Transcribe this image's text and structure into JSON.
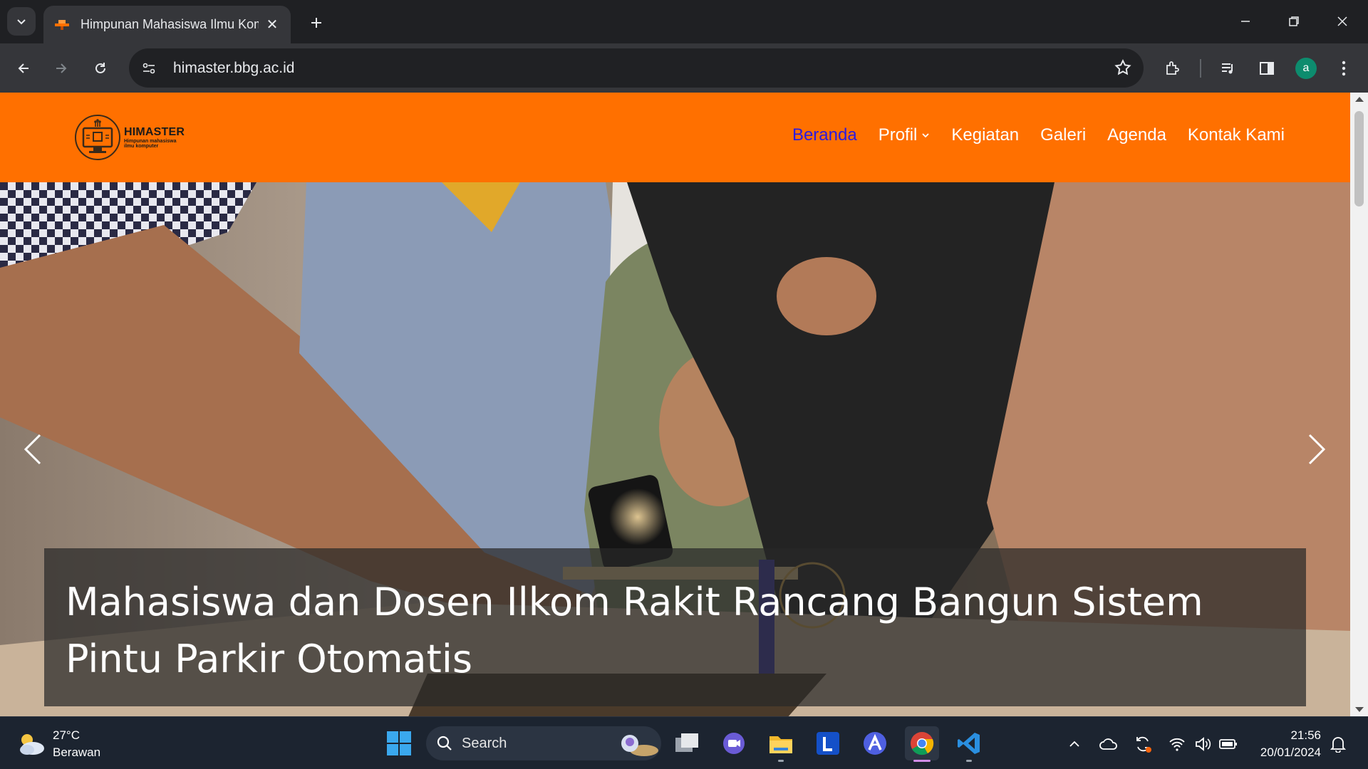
{
  "browser": {
    "tab_title": "Himpunan Mahasiswa Ilmu Komputer",
    "url": "himaster.bbg.ac.id",
    "profile_initial": "a"
  },
  "site": {
    "logo_name": "HIMASTER",
    "logo_sub_line1": "Himpunan mahasiswa",
    "logo_sub_line2": "ilmu komputer",
    "nav": {
      "home": "Beranda",
      "profile": "Profil",
      "activities": "Kegiatan",
      "gallery": "Galeri",
      "agenda": "Agenda",
      "contact": "Kontak Kami"
    },
    "hero_caption": "Mahasiswa dan Dosen Ilkom Rakit Rancang Bangun Sistem Pintu Parkir Otomatis"
  },
  "taskbar": {
    "weather_temp": "27°C",
    "weather_desc": "Berawan",
    "search_label": "Search",
    "time": "21:56",
    "date": "20/01/2024"
  },
  "colors": {
    "header_orange": "#ff7000",
    "nav_active": "#2b1be0",
    "chrome_dark": "#35363a",
    "taskbar": "#1c2430"
  }
}
